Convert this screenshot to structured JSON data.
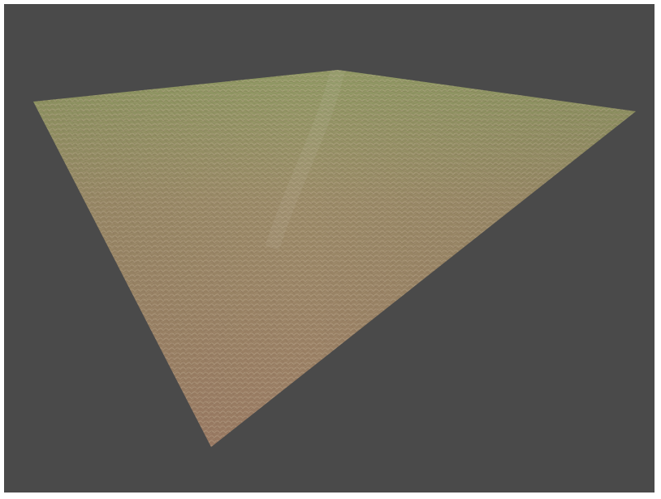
{
  "viewport": {
    "background_color": "#4a4a4a",
    "object": "textured-terrain-plane",
    "colors": {
      "far_tint": "#8e9a62",
      "mid_tint": "#9a8a67",
      "near_tint": "#9a7a63",
      "tile_highlight": "#c9b79d",
      "tile_shadow": "#7a5f4b"
    }
  }
}
